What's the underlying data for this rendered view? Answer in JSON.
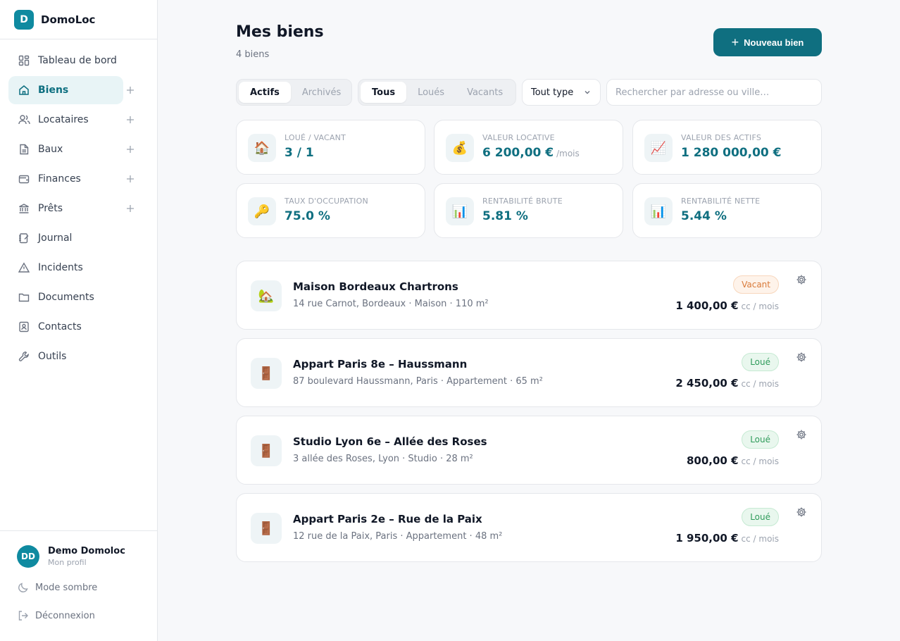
{
  "brand": {
    "logo_letter": "D",
    "name": "DomoLoc"
  },
  "sidebar": {
    "items": [
      {
        "label": "Tableau de bord",
        "icon": "dashboard-icon"
      },
      {
        "label": "Biens",
        "icon": "home-icon"
      },
      {
        "label": "Locataires",
        "icon": "users-icon"
      },
      {
        "label": "Baux",
        "icon": "document-icon"
      },
      {
        "label": "Finances",
        "icon": "wallet-icon"
      },
      {
        "label": "Prêts",
        "icon": "bank-icon"
      },
      {
        "label": "Journal",
        "icon": "journal-icon"
      },
      {
        "label": "Incidents",
        "icon": "warning-icon"
      },
      {
        "label": "Documents",
        "icon": "folder-icon"
      },
      {
        "label": "Contacts",
        "icon": "contact-icon"
      },
      {
        "label": "Outils",
        "icon": "wrench-icon"
      }
    ]
  },
  "profile": {
    "initials": "DD",
    "name": "Demo Domoloc",
    "sub": "Mon profil"
  },
  "bottom": {
    "dark_mode": "Mode sombre",
    "logout": "Déconnexion"
  },
  "header": {
    "title": "Mes biens",
    "count": "4 biens",
    "new_button": "Nouveau bien"
  },
  "filters": {
    "status": [
      "Actifs",
      "Archivés"
    ],
    "occupancy": [
      "Tous",
      "Loués",
      "Vacants"
    ],
    "type_select": "Tout type",
    "search_placeholder": "Rechercher par adresse ou ville…"
  },
  "stats": [
    {
      "label": "Loué / Vacant",
      "value": "3 / 1",
      "unit": "",
      "icon": "🏠"
    },
    {
      "label": "Valeur locative",
      "value": "6 200,00 €",
      "unit": "/mois",
      "icon": "💰"
    },
    {
      "label": "Valeur des actifs",
      "value": "1 280 000,00 €",
      "unit": "",
      "icon": "📈"
    },
    {
      "label": "Taux d'occupation",
      "value": "75.0 %",
      "unit": "",
      "icon": "🔑"
    },
    {
      "label": "Rentabilité brute",
      "value": "5.81 %",
      "unit": "",
      "icon": "📊"
    },
    {
      "label": "Rentabilité nette",
      "value": "5.44 %",
      "unit": "",
      "icon": "📊"
    }
  ],
  "properties": [
    {
      "title": "Maison Bordeaux Chartrons",
      "sub": "14 rue Carnot, Bordeaux · Maison · 110 m²",
      "status": "Vacant",
      "price": "1 400,00 €",
      "price_unit": "cc / mois",
      "icon": "🏡"
    },
    {
      "title": "Appart Paris 8e – Haussmann",
      "sub": "87 boulevard Haussmann, Paris · Appartement · 65 m²",
      "status": "Loué",
      "price": "2 450,00 €",
      "price_unit": "cc / mois",
      "icon": "🚪"
    },
    {
      "title": "Studio Lyon 6e – Allée des Roses",
      "sub": "3 allée des Roses, Lyon · Studio · 28 m²",
      "status": "Loué",
      "price": "800,00 €",
      "price_unit": "cc / mois",
      "icon": "🚪"
    },
    {
      "title": "Appart Paris 2e – Rue de la Paix",
      "sub": "12 rue de la Paix, Paris · Appartement · 48 m²",
      "status": "Loué",
      "price": "1 950,00 €",
      "price_unit": "cc / mois",
      "icon": "🚪"
    }
  ]
}
